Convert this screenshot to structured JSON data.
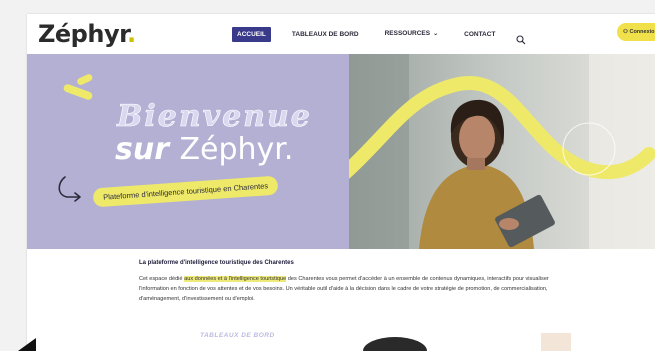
{
  "header": {
    "logo_text": "Zéphyr",
    "logo_dot": ".",
    "nav": [
      {
        "label": "ACCUEIL",
        "active": true
      },
      {
        "label": "TABLEAUX DE BORD",
        "active": false
      },
      {
        "label": "RESSOURCES",
        "active": false,
        "has_dropdown": true
      },
      {
        "label": "CONTACT",
        "active": false
      }
    ],
    "cta_label": "Connexio"
  },
  "hero": {
    "title_line1": "Bienvenue",
    "title_line2_prefix": "sur ",
    "title_line2_brand": "Zéphyr.",
    "tagline": "Plateforme d'intelligence touristique en Charentes"
  },
  "intro": {
    "heading": "La plateforme d'intelligence touristique des Charentes",
    "text_before": "Cet espace dédié ",
    "text_highlight": "aux données et à l'intelligence touristique",
    "text_after": " des Charentes vous permet d'accéder à un ensemble de contenus dynamiques, interactifs pour visualiser l'information en fonction de vos attentes et de vos besoins. Un véritable outil d'aide à la décision dans le cadre de votre stratégie de promotion, de commercialisation, d'aménagement, d'investissement ou d'emploi."
  },
  "dashboards": {
    "title": "TABLEAUX DE BORD"
  },
  "colors": {
    "brand_navy": "#3a3a8a",
    "accent_yellow": "#efe96a",
    "hero_lavender": "#b3b0d3"
  }
}
